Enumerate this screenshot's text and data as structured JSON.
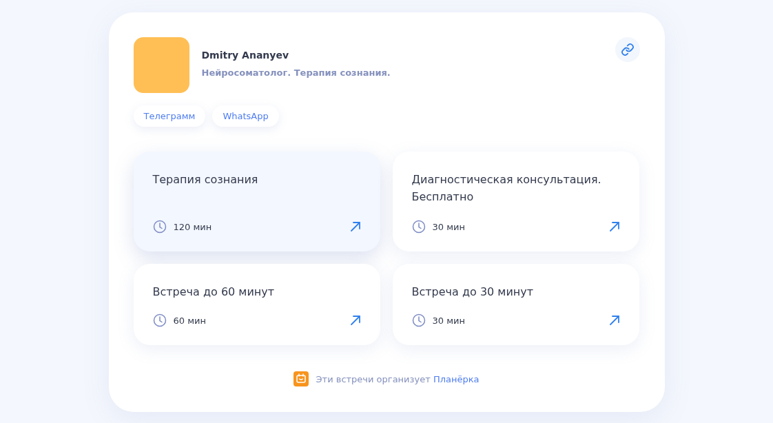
{
  "profile": {
    "name": "Dmitry Ananyev",
    "subtitle": "Нейросоматолог. Терапия сознания."
  },
  "contacts": [
    {
      "label": "Телеграмм"
    },
    {
      "label": "WhatsApp"
    }
  ],
  "events": [
    {
      "title": "Терапия сознания",
      "duration": "120 мин",
      "selected": true
    },
    {
      "title": "Диагностическая консультация. Бесплатно",
      "duration": "30 мин",
      "selected": false
    },
    {
      "title": "Встреча до 60 минут",
      "duration": "60 мин",
      "selected": false
    },
    {
      "title": "Встреча до 30 минут",
      "duration": "30 мин",
      "selected": false
    }
  ],
  "footer": {
    "text": "Эти встречи организует",
    "link": "Планёрка"
  }
}
